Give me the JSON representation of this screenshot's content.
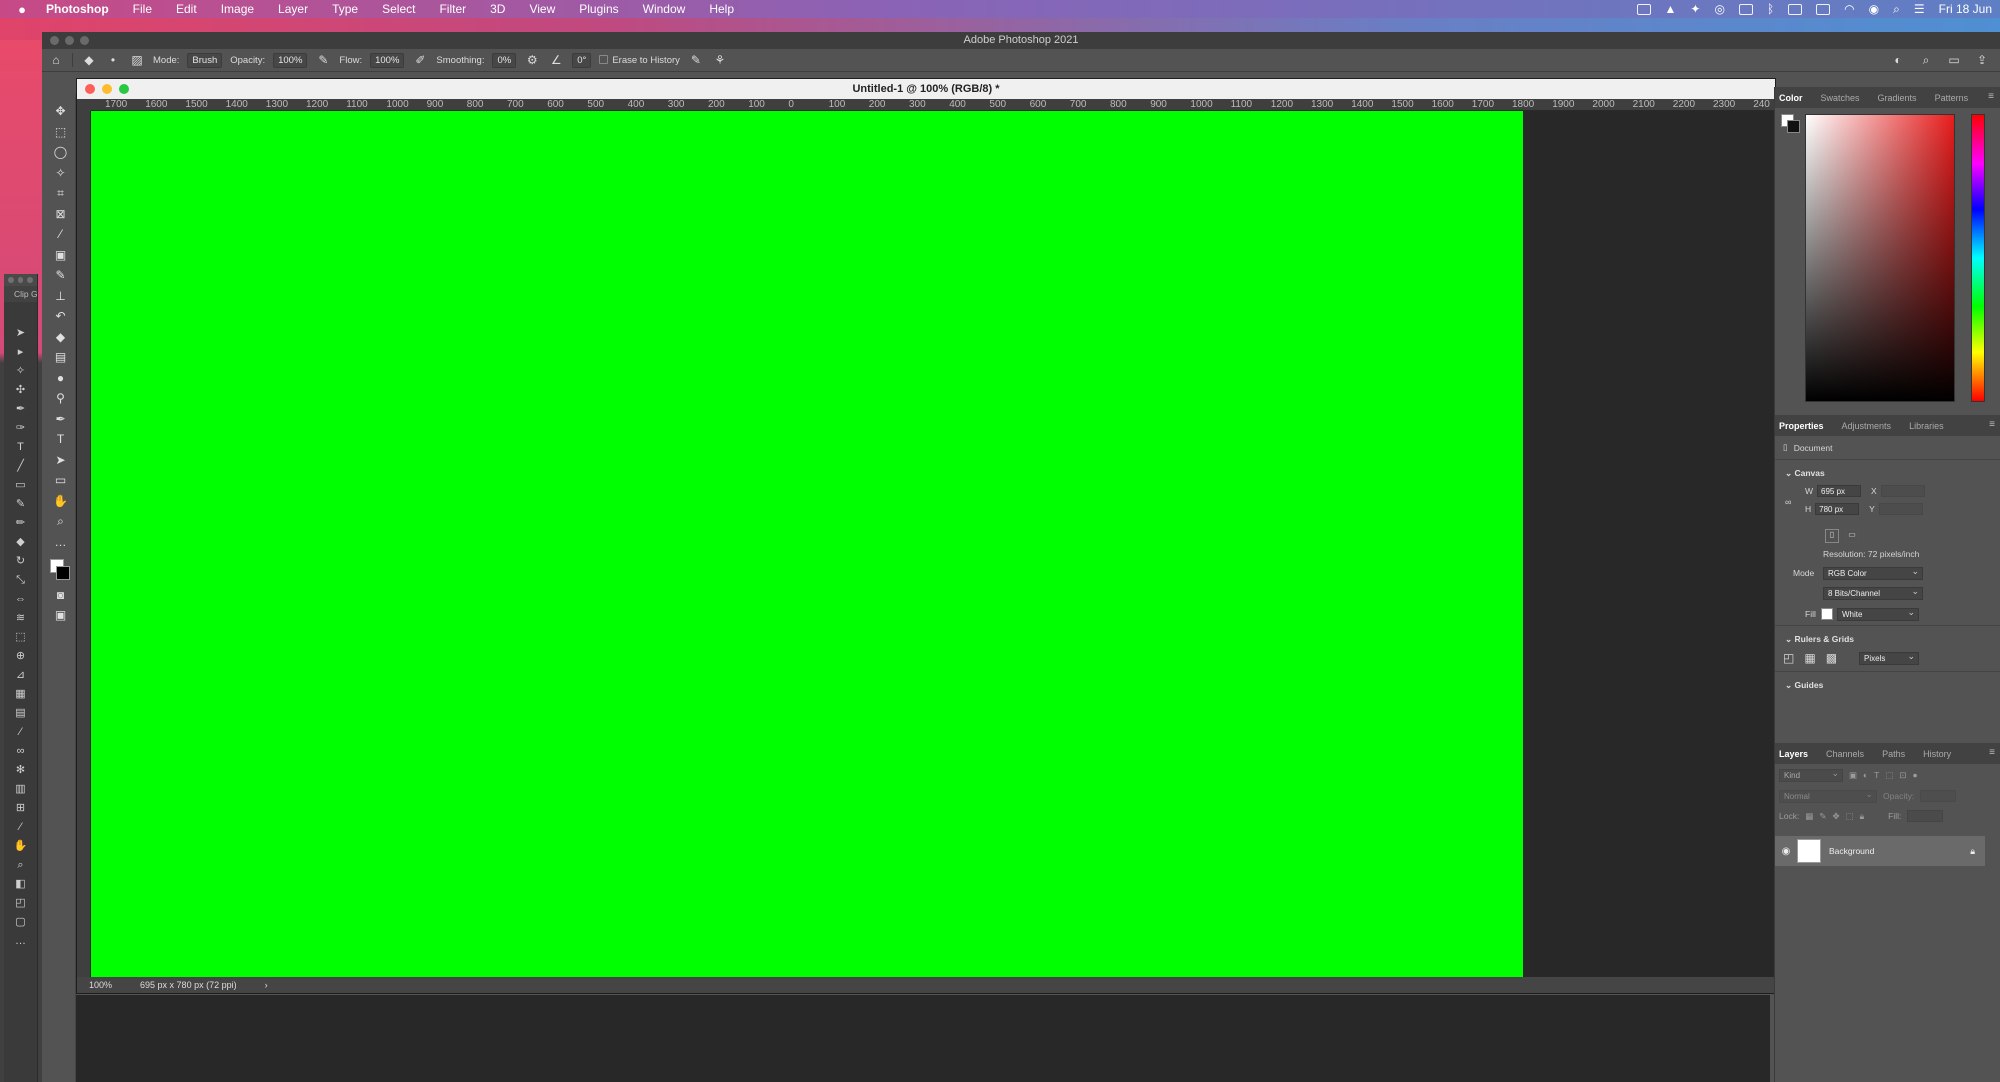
{
  "menubar": {
    "apple": "",
    "items": [
      "Photoshop",
      "File",
      "Edit",
      "Image",
      "Layer",
      "Type",
      "Select",
      "Filter",
      "3D",
      "View",
      "Plugins",
      "Window",
      "Help"
    ],
    "date": "Fri 18 Jun"
  },
  "app": {
    "title": "Adobe Photoshop 2021"
  },
  "options": {
    "mode_label": "Mode:",
    "mode_value": "Brush",
    "opacity_label": "Opacity:",
    "opacity_value": "100%",
    "flow_label": "Flow:",
    "flow_value": "100%",
    "smoothing_label": "Smoothing:",
    "smoothing_value": "0%",
    "angle_value": "0°",
    "erase_history_label": "Erase to History"
  },
  "panel2": {
    "tab": "Clip Gro"
  },
  "document": {
    "title": "Untitled-1 @ 100% (RGB/8) *",
    "ruler_labels": [
      "1700",
      "1600",
      "1500",
      "1400",
      "1300",
      "1200",
      "1100",
      "1000",
      "900",
      "800",
      "700",
      "600",
      "500",
      "400",
      "300",
      "200",
      "100",
      "0",
      "100",
      "200",
      "300",
      "400",
      "500",
      "600",
      "700",
      "800",
      "900",
      "1000",
      "1100",
      "1200",
      "1300",
      "1400",
      "1500",
      "1600",
      "1700",
      "1800",
      "1900",
      "2000",
      "2100",
      "2200",
      "2300",
      "240"
    ],
    "zoom": "100%",
    "info": "695 px x 780 px (72 ppi)",
    "canvas_color": "#00ff00"
  },
  "color_panel": {
    "tabs": [
      "Color",
      "Swatches",
      "Gradients",
      "Patterns"
    ]
  },
  "properties": {
    "tabs": [
      "Properties",
      "Adjustments",
      "Libraries"
    ],
    "doc_label": "Document",
    "canvas_section": "Canvas",
    "w_label": "W",
    "w_value": "695 px",
    "h_label": "H",
    "h_value": "780 px",
    "x_label": "X",
    "y_label": "Y",
    "resolution": "Resolution: 72 pixels/inch",
    "mode_label": "Mode",
    "mode_value": "RGB Color",
    "bits_value": "8 Bits/Channel",
    "fill_label": "Fill",
    "fill_value": "White",
    "rulers_section": "Rulers & Grids",
    "units_value": "Pixels",
    "guides_section": "Guides"
  },
  "layers_panel": {
    "tabs": [
      "Layers",
      "Channels",
      "Paths",
      "History"
    ],
    "kind_label": "Kind",
    "blend_value": "Normal",
    "opacity_label": "Opacity:",
    "lock_label": "Lock:",
    "fill_label": "Fill:",
    "layer_name": "Background"
  }
}
